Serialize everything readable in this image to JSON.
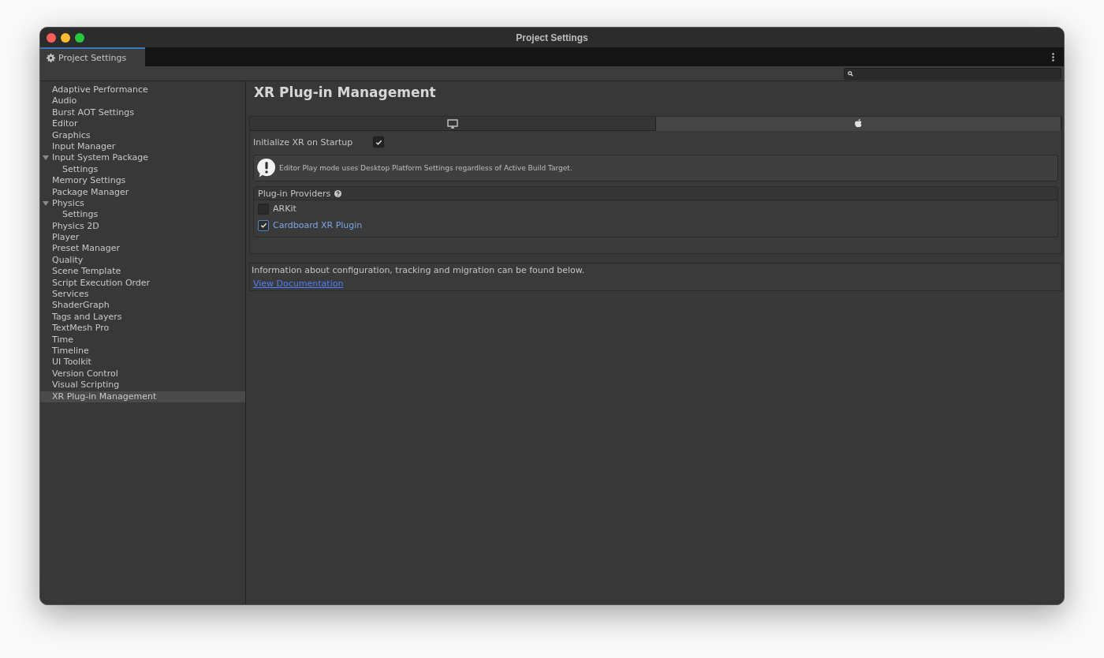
{
  "window": {
    "title": "Project Settings"
  },
  "tabs": [
    {
      "label": "Project Settings",
      "selected": true
    }
  ],
  "sidebar": {
    "items": [
      {
        "label": "Adaptive Performance",
        "selected": false
      },
      {
        "label": "Audio",
        "selected": false
      },
      {
        "label": "Burst AOT Settings",
        "selected": false
      },
      {
        "label": "Editor",
        "selected": false
      },
      {
        "label": "Graphics",
        "selected": false
      },
      {
        "label": "Input Manager",
        "selected": false
      },
      {
        "label": "Input System Package",
        "selected": false,
        "expanded": true,
        "children": [
          {
            "label": "Settings",
            "selected": false
          }
        ]
      },
      {
        "label": "Memory Settings",
        "selected": false
      },
      {
        "label": "Package Manager",
        "selected": false
      },
      {
        "label": "Physics",
        "selected": false,
        "expanded": true,
        "children": [
          {
            "label": "Settings",
            "selected": false
          }
        ]
      },
      {
        "label": "Physics 2D",
        "selected": false
      },
      {
        "label": "Player",
        "selected": false
      },
      {
        "label": "Preset Manager",
        "selected": false
      },
      {
        "label": "Quality",
        "selected": false
      },
      {
        "label": "Scene Template",
        "selected": false
      },
      {
        "label": "Script Execution Order",
        "selected": false
      },
      {
        "label": "Services",
        "selected": false
      },
      {
        "label": "ShaderGraph",
        "selected": false
      },
      {
        "label": "Tags and Layers",
        "selected": false
      },
      {
        "label": "TextMesh Pro",
        "selected": false
      },
      {
        "label": "Time",
        "selected": false
      },
      {
        "label": "Timeline",
        "selected": false
      },
      {
        "label": "UI Toolkit",
        "selected": false
      },
      {
        "label": "Version Control",
        "selected": false
      },
      {
        "label": "Visual Scripting",
        "selected": false
      },
      {
        "label": "XR Plug-in Management",
        "selected": true
      }
    ]
  },
  "content": {
    "title": "XR Plug-in Management",
    "platform_tabs": [
      {
        "kind": "desktop",
        "selected": false
      },
      {
        "kind": "apple",
        "selected": true
      }
    ],
    "initialize_on_startup": {
      "label": "Initialize XR on Startup",
      "checked": true
    },
    "info_box": {
      "text": "Editor Play mode uses Desktop Platform Settings regardless of Active Build Target."
    },
    "providers": {
      "title": "Plug-in Providers",
      "items": [
        {
          "label": "ARKit",
          "checked": false
        },
        {
          "label": "Cardboard XR Plugin",
          "checked": true
        }
      ]
    },
    "documentation": {
      "text": "Information about configuration, tracking and migration can be found below.",
      "link": "View Documentation"
    }
  }
}
